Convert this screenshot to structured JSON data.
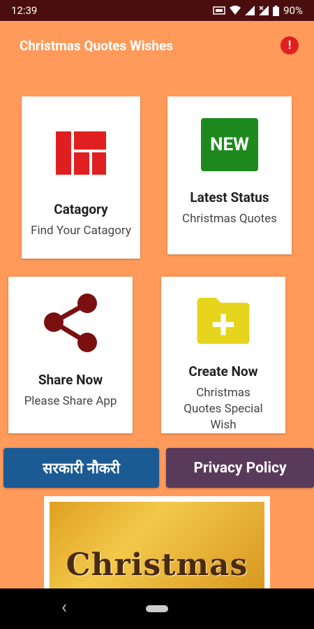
{
  "status": {
    "time": "12:39",
    "battery": "90%"
  },
  "app": {
    "title": "Christmas Quotes Wishes"
  },
  "cards": [
    {
      "title": "Catagory",
      "sub": "Find Your Catagory"
    },
    {
      "title": "Latest Status",
      "sub": "Christmas Quotes",
      "badge": "NEW"
    },
    {
      "title": "Share Now",
      "sub": "Please Share App"
    },
    {
      "title": "Create Now",
      "sub": "Christmas Quotes Special Wish"
    }
  ],
  "buttons": {
    "sarkari": "सरकारी नौकरी",
    "privacy": "Privacy Policy"
  },
  "banner": {
    "text": "Christmas"
  },
  "colors": {
    "background": "#ff9a5a",
    "status_bar": "#4a0e0e",
    "sarkari_button": "#1c5a94",
    "privacy_button": "#5a3a5a"
  }
}
